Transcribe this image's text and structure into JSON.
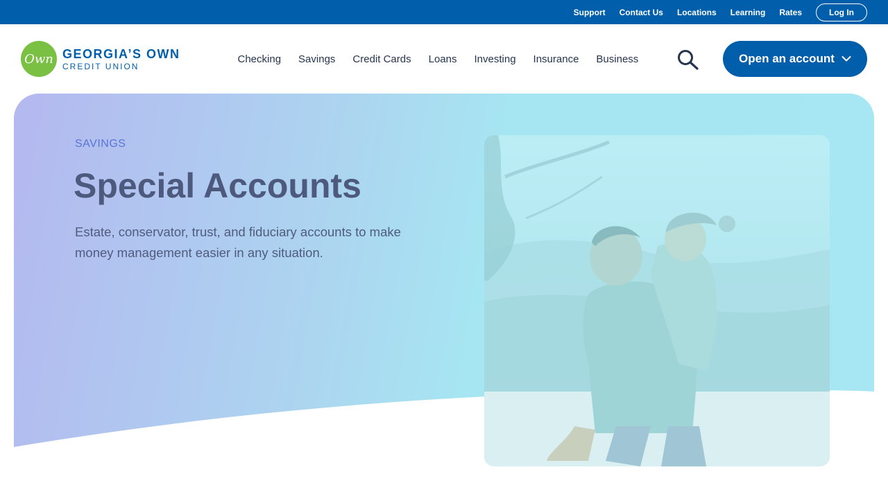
{
  "utility_nav": {
    "links": [
      "Support",
      "Contact Us",
      "Locations",
      "Learning",
      "Rates"
    ],
    "login_label": "Log In"
  },
  "logo": {
    "badge_text": "Own",
    "line1": "GEORGIA’S OWN",
    "line2": "CREDIT UNION"
  },
  "main_nav": {
    "items": [
      "Checking",
      "Savings",
      "Credit Cards",
      "Loans",
      "Investing",
      "Insurance",
      "Business"
    ]
  },
  "search": {
    "icon": "search-icon"
  },
  "cta": {
    "label": "Open an account",
    "icon": "chevron-down-icon"
  },
  "hero": {
    "eyebrow": "SAVINGS",
    "title": "Special Accounts",
    "description": "Estate, conservator, trust, and fiduciary accounts to make money management easier in any situation.",
    "image": "father-carrying-son-photo"
  },
  "colors": {
    "brand_blue": "#005eaa",
    "logo_green": "#7ac143",
    "eyebrow_blue": "#5a75d6",
    "heading": "#4d5a7e",
    "hero_gradient_start": "#b4b8ef",
    "hero_gradient_end": "#a6e7f3"
  }
}
